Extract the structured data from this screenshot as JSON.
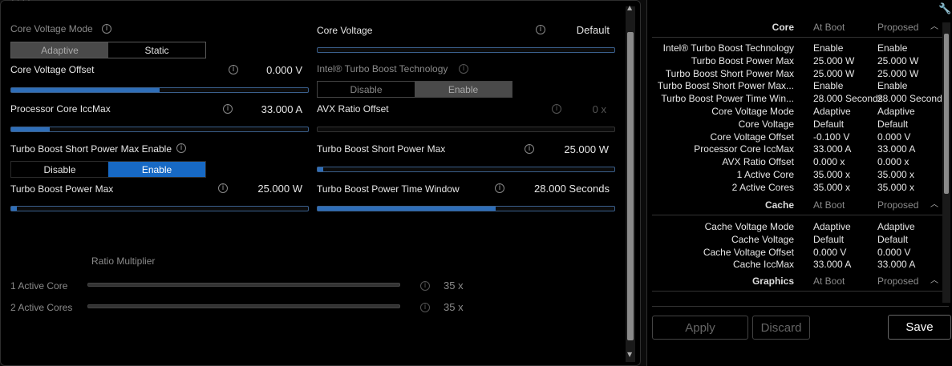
{
  "left": {
    "core_voltage_mode": {
      "label": "Core Voltage Mode",
      "options": [
        "Adaptive",
        "Static"
      ],
      "selected": "Adaptive"
    },
    "core_voltage": {
      "label": "Core Voltage",
      "value": "Default"
    },
    "core_voltage_offset": {
      "label": "Core Voltage Offset",
      "value": "0.000 V",
      "level": 0.5
    },
    "turbo_boost_tech": {
      "label": "Intel® Turbo Boost Technology",
      "options": [
        "Disable",
        "Enable"
      ],
      "selected": "Enable"
    },
    "processor_core_iccmax": {
      "label": "Processor Core IccMax",
      "value": "33.000 A",
      "level": 0.13
    },
    "avx_ratio_offset": {
      "label": "AVX Ratio Offset",
      "value": "0 x"
    },
    "short_power_max_enable": {
      "label": "Turbo Boost Short Power Max Enable",
      "options": [
        "Disable",
        "Enable"
      ],
      "selected": "Enable"
    },
    "short_power_max": {
      "label": "Turbo Boost Short Power Max",
      "value": "25.000 W",
      "level": 0.02
    },
    "power_max": {
      "label": "Turbo Boost Power Max",
      "value": "25.000 W",
      "level": 0.02
    },
    "power_time_window": {
      "label": "Turbo Boost Power Time Window",
      "value": "28.000 Seconds",
      "level": 0.6
    },
    "ratio_multiplier": {
      "label": "Ratio Multiplier"
    },
    "ratios": [
      {
        "label": "1 Active Core",
        "value": "35 x"
      },
      {
        "label": "2 Active Cores",
        "value": "35 x"
      }
    ]
  },
  "right": {
    "col_at_boot": "At Boot",
    "col_proposed": "Proposed",
    "core": {
      "title": "Core",
      "rows": [
        {
          "label": "Intel® Turbo Boost Technology",
          "boot": "Enable",
          "proposed": "Enable"
        },
        {
          "label": "Turbo Boost Power Max",
          "boot": "25.000 W",
          "proposed": "25.000 W"
        },
        {
          "label": "Turbo Boost Short Power Max",
          "boot": "25.000 W",
          "proposed": "25.000 W"
        },
        {
          "label": "Turbo Boost Short Power Max...",
          "boot": "Enable",
          "proposed": "Enable"
        },
        {
          "label": "Turbo Boost Power Time Win...",
          "boot": "28.000 Seconds",
          "proposed": "28.000 Seconds"
        },
        {
          "label": "Core Voltage Mode",
          "boot": "Adaptive",
          "proposed": "Adaptive"
        },
        {
          "label": "Core Voltage",
          "boot": "Default",
          "proposed": "Default"
        },
        {
          "label": "Core Voltage Offset",
          "boot": "-0.100 V",
          "proposed": "0.000 V"
        },
        {
          "label": "Processor Core IccMax",
          "boot": "33.000 A",
          "proposed": "33.000 A"
        },
        {
          "label": "AVX Ratio Offset",
          "boot": "0.000 x",
          "proposed": "0.000 x"
        },
        {
          "label": "1 Active Core",
          "boot": "35.000 x",
          "proposed": "35.000 x"
        },
        {
          "label": "2 Active Cores",
          "boot": "35.000 x",
          "proposed": "35.000 x"
        }
      ]
    },
    "cache": {
      "title": "Cache",
      "rows": [
        {
          "label": "Cache Voltage Mode",
          "boot": "Adaptive",
          "proposed": "Adaptive"
        },
        {
          "label": "Cache Voltage",
          "boot": "Default",
          "proposed": "Default"
        },
        {
          "label": "Cache Voltage Offset",
          "boot": "0.000 V",
          "proposed": "0.000 V"
        },
        {
          "label": "Cache IccMax",
          "boot": "33.000 A",
          "proposed": "33.000 A"
        }
      ]
    },
    "graphics": {
      "title": "Graphics"
    },
    "buttons": {
      "apply": "Apply",
      "discard": "Discard",
      "save": "Save"
    }
  }
}
